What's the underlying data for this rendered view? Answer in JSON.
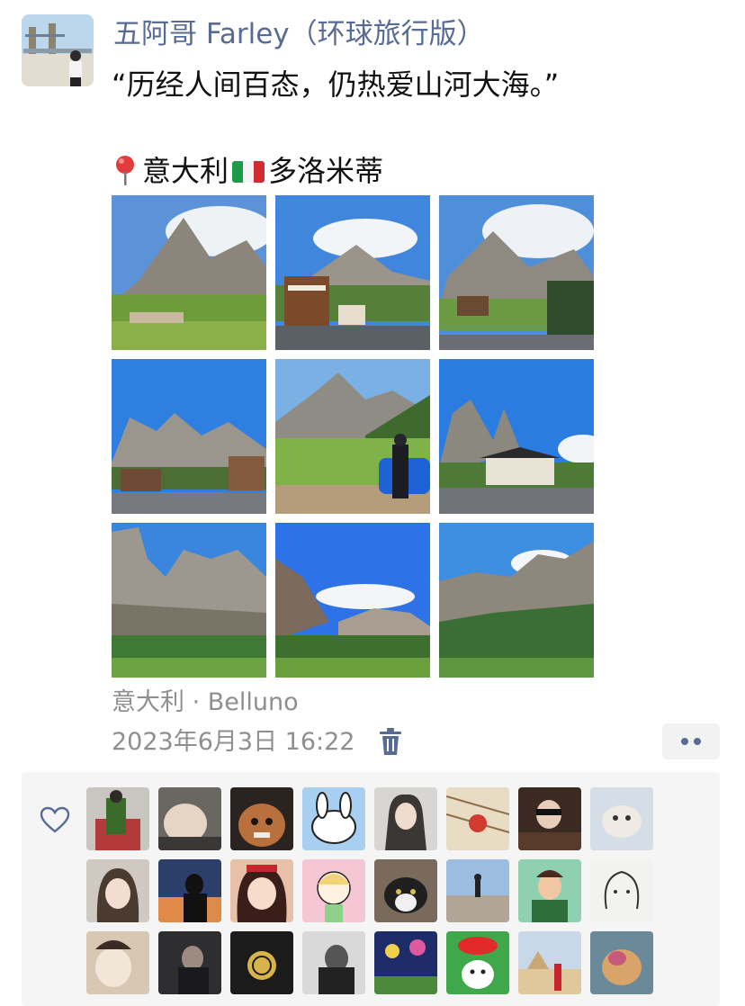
{
  "post": {
    "author": "五阿哥 Farley（环球旅行版）",
    "author_avatar": "avatar-tower-bridge",
    "text_line1": "“历经人间百态，仍热爱山河大海。”",
    "location_part1": "意大利",
    "location_part2": "多洛米蒂",
    "pin_icon": "red-pin-icon",
    "flag_icon": "italy-flag-icon",
    "photo_count": 9,
    "place": "意大利 · Belluno",
    "timestamp": "2023年6月3日 16:22",
    "delete_icon": "trash-icon",
    "more_icon": "more-dots-icon"
  },
  "likes": {
    "icon": "heart-icon",
    "visible_avatars": 24
  },
  "colors": {
    "name_blue": "#576b95",
    "meta_gray": "#8f8f8f",
    "panel_bg": "#f5f5f5"
  }
}
